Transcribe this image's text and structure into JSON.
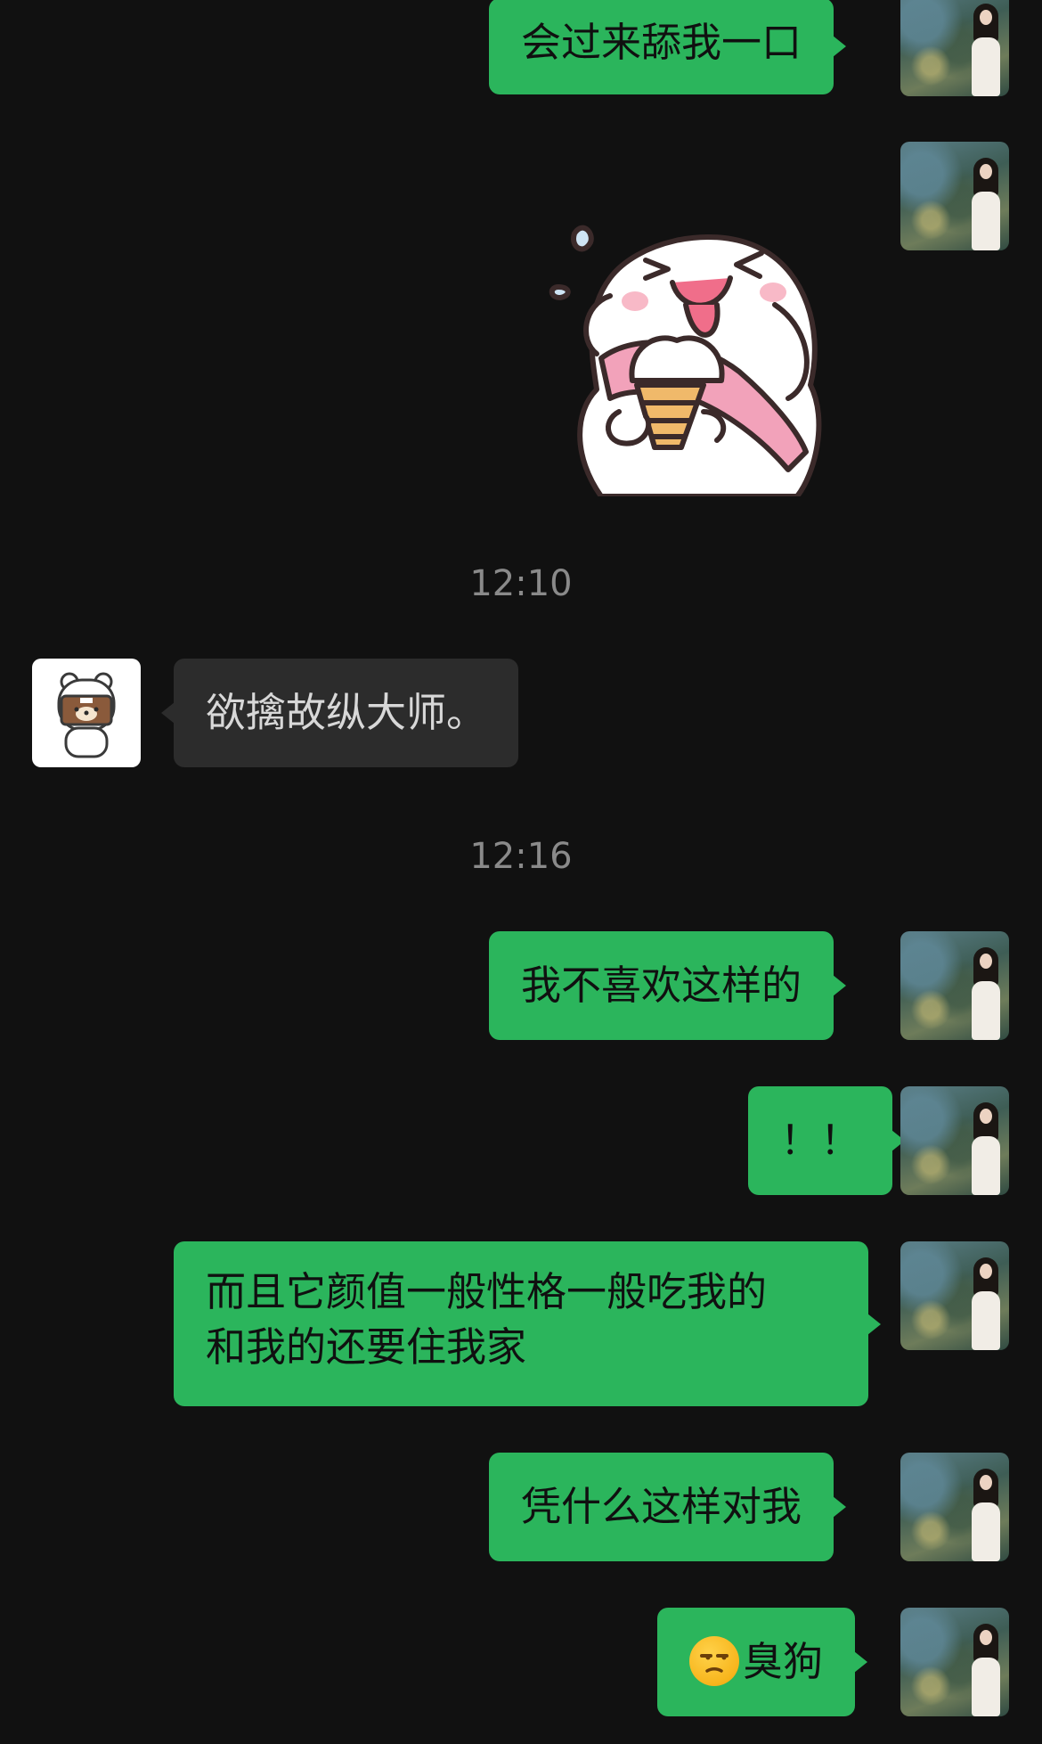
{
  "messages": [
    {
      "id": "m1",
      "direction": "outgoing",
      "text": "会过来舔我一口"
    },
    {
      "id": "m2",
      "direction": "outgoing",
      "type": "sticker",
      "sticker": "bunny-eating-ice-cream-sticker"
    },
    {
      "id": "t1",
      "type": "timestamp",
      "text": "12:10"
    },
    {
      "id": "m3",
      "direction": "incoming",
      "text": "欲擒故纵大师。"
    },
    {
      "id": "t2",
      "type": "timestamp",
      "text": "12:16"
    },
    {
      "id": "m4",
      "direction": "outgoing",
      "text": "我不喜欢这样的"
    },
    {
      "id": "m5",
      "direction": "outgoing",
      "text": "！！"
    },
    {
      "id": "m6",
      "direction": "outgoing",
      "lines": [
        "而且它颜值一般性格一般吃我的",
        "和我的还要住我家"
      ]
    },
    {
      "id": "m7",
      "direction": "outgoing",
      "text": "凭什么这样对我"
    },
    {
      "id": "m8",
      "direction": "outgoing",
      "emoji": "unamused-face-emoji",
      "text": "臭狗"
    }
  ],
  "colors": {
    "background": "#111111",
    "outgoing_bubble": "#2bb55c",
    "incoming_bubble": "#2c2c2c",
    "timestamp": "#8a8a8a"
  }
}
